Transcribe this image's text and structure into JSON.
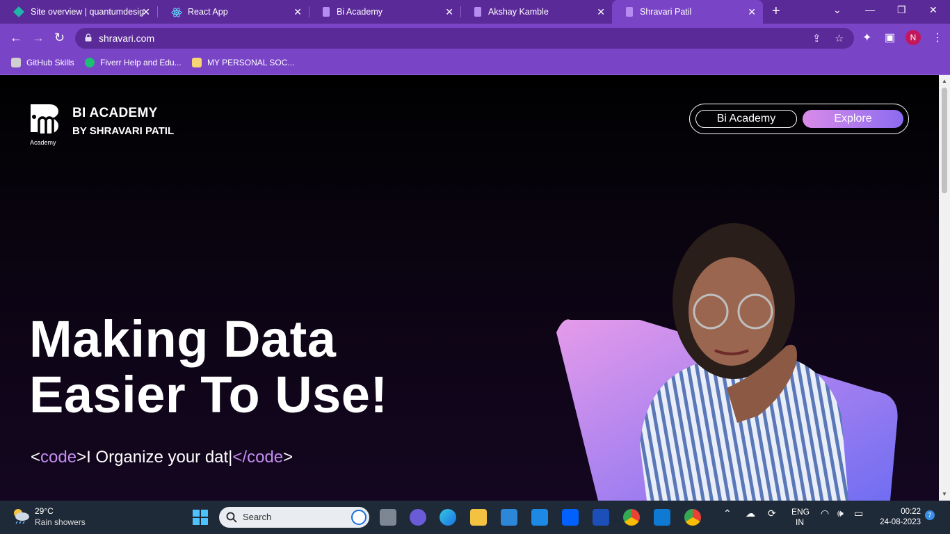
{
  "browser": {
    "tabs": [
      {
        "title": "Site overview | quantumdesig",
        "icon": "netlify-icon",
        "active": false
      },
      {
        "title": "React App",
        "icon": "react-icon",
        "active": false
      },
      {
        "title": "Bi Academy",
        "icon": "bi-academy-icon",
        "active": false
      },
      {
        "title": "Akshay Kamble",
        "icon": "bi-academy-icon",
        "active": false
      },
      {
        "title": "Shravari Patil",
        "icon": "bi-academy-icon",
        "active": true
      }
    ],
    "url": "shravari.com",
    "profile_initial": "N",
    "bookmarks": [
      {
        "label": "GitHub Skills",
        "icon": "github-icon"
      },
      {
        "label": "Fiverr Help and Edu...",
        "icon": "fiverr-icon"
      },
      {
        "label": "MY PERSONAL SOC...",
        "icon": "folder-icon"
      }
    ]
  },
  "site": {
    "brand_title": "BI ACADEMY",
    "brand_subtitle": "BY SHRAVARI PATIL",
    "logo_caption": "Academy",
    "nav": {
      "bi_academy_label": "Bi Academy",
      "explore_label": "Explore"
    },
    "hero_line1": "Making Data",
    "hero_line2": "Easier To Use!",
    "typewriter": {
      "open_bracket": "<",
      "open_keyword": "code",
      "close_bracket_open": ">",
      "text": "I Organize your dat|",
      "close_open": "</",
      "close_keyword": "code",
      "close_end": ">"
    },
    "colors": {
      "accent_pink": "#d98be8",
      "accent_purple": "#8c6bf0",
      "keyword": "#c58cf2"
    }
  },
  "taskbar": {
    "weather_temp": "29°C",
    "weather_desc": "Rain showers",
    "search_placeholder": "Search",
    "language_line1": "ENG",
    "language_line2": "IN",
    "time": "00:22",
    "date": "24-08-2023",
    "notification_count": "7"
  }
}
